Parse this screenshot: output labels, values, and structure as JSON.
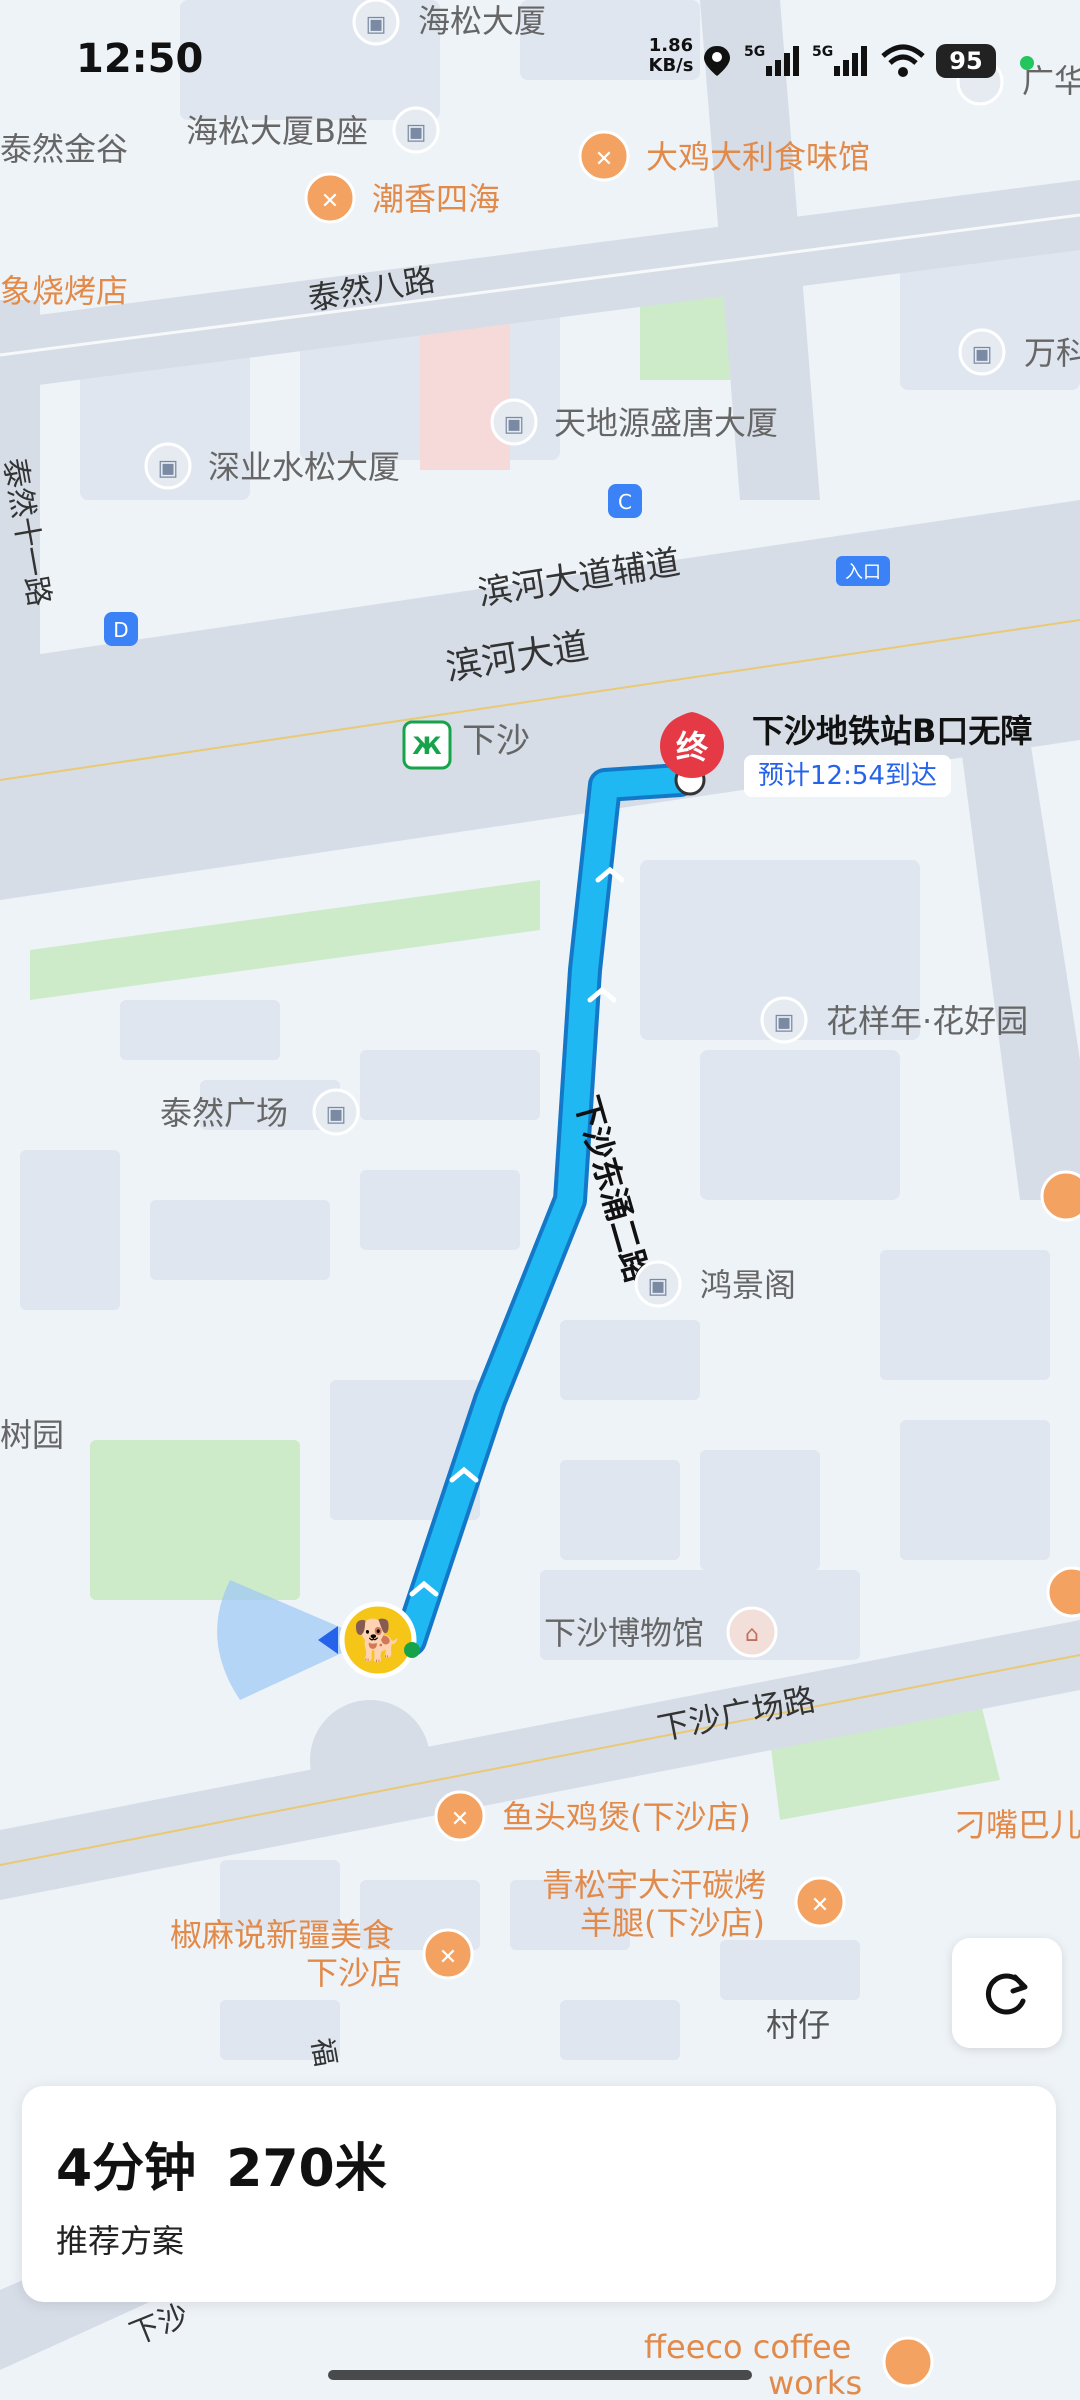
{
  "status_bar": {
    "time": "12:50",
    "net_speed": "1.86",
    "net_unit": "KB/s",
    "sim1": "5G",
    "sim2": "5G",
    "battery": "95"
  },
  "map": {
    "labels": {
      "haisong": "海松大厦",
      "haisong_b": "海松大厦B座",
      "tairan_jingu": "泰然金谷",
      "dajidali": "大鸡大利食味馆",
      "chaoxiang": "潮香四海",
      "bbq": "象烧烤店",
      "tairan8": "泰然八路",
      "tiandiyuan": "天地源盛唐大厦",
      "shenye": "深业水松大厦",
      "tairan11": "泰然十一路",
      "binhe_fu": "滨河大道辅道",
      "binhe": "滨河大道",
      "entrance": "入口",
      "xiasha_station": "下沙",
      "huayang": "花样年·花好园",
      "tairan_plaza": "泰然广场",
      "road_vertical": "下沙东涌二路",
      "hongjing": "鸿景阁",
      "shuyuan": "树园",
      "museum": "下沙博物馆",
      "xiasha_guangchang": "下沙广场路",
      "yutou": "鱼头鸡煲(下沙店)",
      "qingsong_1": "青松宇大汗碳烤",
      "qingsong_2": "羊腿(下沙店)",
      "jiaomashuo_1": "椒麻说新疆美食",
      "jiaomashuo_2": "下沙店",
      "diaozui": "刁嘴巴儿",
      "cunzai": "村仔",
      "ffeeco_1": "ffeeco coffee",
      "ffeeco_2": "works",
      "wanke": "万科",
      "guang": "广华",
      "fu": "福",
      "xiasha_bottom": "下沙",
      "marker_c": "C",
      "marker_d": "D"
    }
  },
  "destination": {
    "marker": "终",
    "title": "下沙地铁站B口无障",
    "eta": "预计12:54到达"
  },
  "route_summary": {
    "duration": "4分钟",
    "distance": "270米",
    "plan_label": "推荐方案"
  },
  "icons": {
    "refresh": "refresh-icon",
    "location": "location-icon",
    "wifi": "wifi-icon",
    "poi": "building-icon",
    "food": "restaurant-icon",
    "metro": "metro-icon"
  },
  "colors": {
    "route": "#1fb8f2",
    "route_border": "#1478c8",
    "destination": "#e53945",
    "poi_food": "#f4a261",
    "map_bg": "#eef3f8",
    "road": "#d7dde6"
  }
}
